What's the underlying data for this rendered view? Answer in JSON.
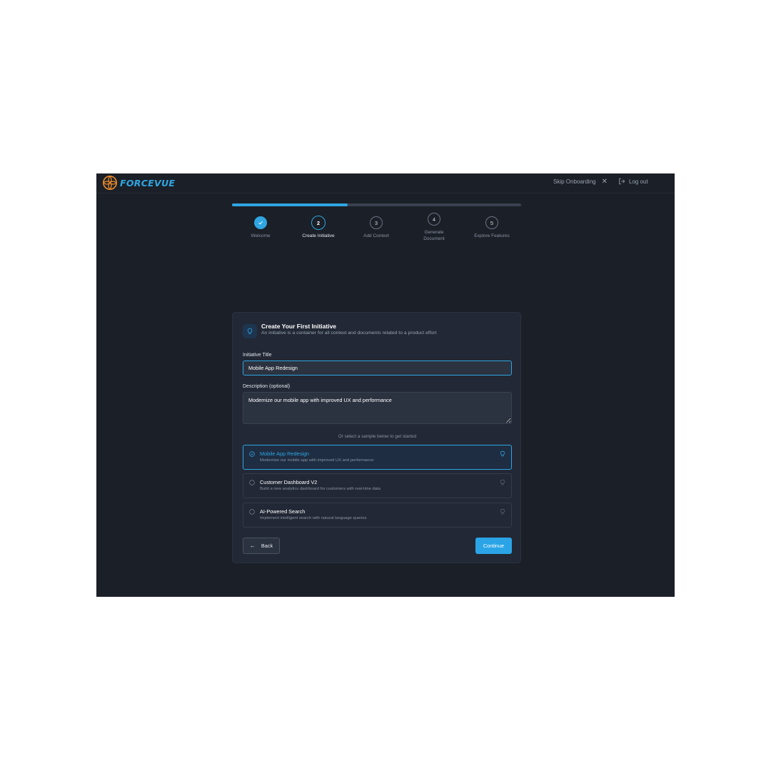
{
  "header": {
    "logo_text": "FORCEVUE",
    "skip_label": "Skip Onboarding",
    "logout_label": "Log out"
  },
  "progress": {
    "fraction": 0.4
  },
  "steps": [
    {
      "number": "1",
      "label": "Welcome",
      "state": "done"
    },
    {
      "number": "2",
      "label": "Create Initiative",
      "state": "active"
    },
    {
      "number": "3",
      "label": "Add Context",
      "state": "pending"
    },
    {
      "number": "4",
      "label": "Generate Document",
      "state": "pending"
    },
    {
      "number": "5",
      "label": "Explore Features",
      "state": "pending"
    }
  ],
  "card": {
    "title": "Create Your First Initiative",
    "subtitle": "An initiative is a container for all context and documents related to a product effort",
    "title_label": "Initiative Title",
    "title_value": "Mobile App Redesign",
    "desc_label": "Description (optional)",
    "desc_value": "Modernize our mobile app with improved UX and performance",
    "sample_prompt": "Or select a sample below to get started",
    "samples": [
      {
        "title": "Mobile App Redesign",
        "desc": "Modernize our mobile app with improved UX and performance",
        "selected": true
      },
      {
        "title": "Customer Dashboard V2",
        "desc": "Build a new analytics dashboard for customers with real-time data",
        "selected": false
      },
      {
        "title": "AI-Powered Search",
        "desc": "Implement intelligent search with natural language queries",
        "selected": false
      }
    ],
    "back_label": "Back",
    "continue_label": "Continue"
  },
  "colors": {
    "accent": "#2fa6e2",
    "background": "#1b1f27",
    "card": "#222835",
    "logo_mark": "#e8892b"
  },
  "icons": [
    "forcevue-logo-icon",
    "close-icon",
    "logout-icon",
    "check-icon",
    "lightbulb-icon",
    "radio-checked-icon",
    "radio-icon",
    "arrow-left-icon"
  ]
}
